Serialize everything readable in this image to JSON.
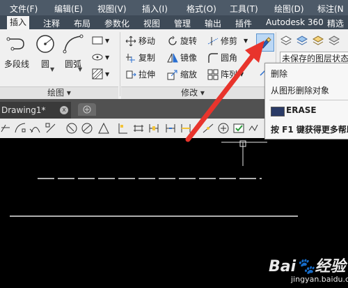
{
  "menu": [
    {
      "label": "文件(F)"
    },
    {
      "label": "编辑(E)"
    },
    {
      "label": "视图(V)"
    },
    {
      "label": "插入(I)"
    },
    {
      "label": "格式(O)"
    },
    {
      "label": "工具(T)"
    },
    {
      "label": "绘图(D)"
    },
    {
      "label": "标注(N"
    }
  ],
  "ribbon_tabs": [
    {
      "label": "插入"
    },
    {
      "label": "注释"
    },
    {
      "label": "布局"
    },
    {
      "label": "参数化"
    },
    {
      "label": "视图"
    },
    {
      "label": "管理"
    },
    {
      "label": "输出"
    },
    {
      "label": "插件"
    },
    {
      "label": "Autodesk 360"
    },
    {
      "label": "精选"
    }
  ],
  "draw_panel": {
    "polyline": "多段线",
    "circle": "圆",
    "arc": "圆弧",
    "title": "绘图 ▾"
  },
  "modify_panel": {
    "move": "移动",
    "rotate": "旋转",
    "trim": "修剪",
    "copy": "复制",
    "mirror": "镜像",
    "fillet": "圆角",
    "stretch": "拉伸",
    "scale": "缩放",
    "array": "阵列",
    "title": "修改 ▾"
  },
  "layer_panel": {
    "status": "未保存的图层状态"
  },
  "tooltip": {
    "title": "删除",
    "desc": "从图形删除对象",
    "command": "ERASE",
    "help": "按 F1 键获得更多帮助"
  },
  "document": {
    "tab": "Drawing1*",
    "close": "x"
  },
  "watermark": {
    "logo": "Bai🐾经验",
    "site": "jingyan.baidu.com"
  },
  "colors": {
    "menubar": "#4d5a68",
    "ribbon": "#f0f0f0",
    "canvas": "#000000",
    "arrow": "#e8342c"
  }
}
